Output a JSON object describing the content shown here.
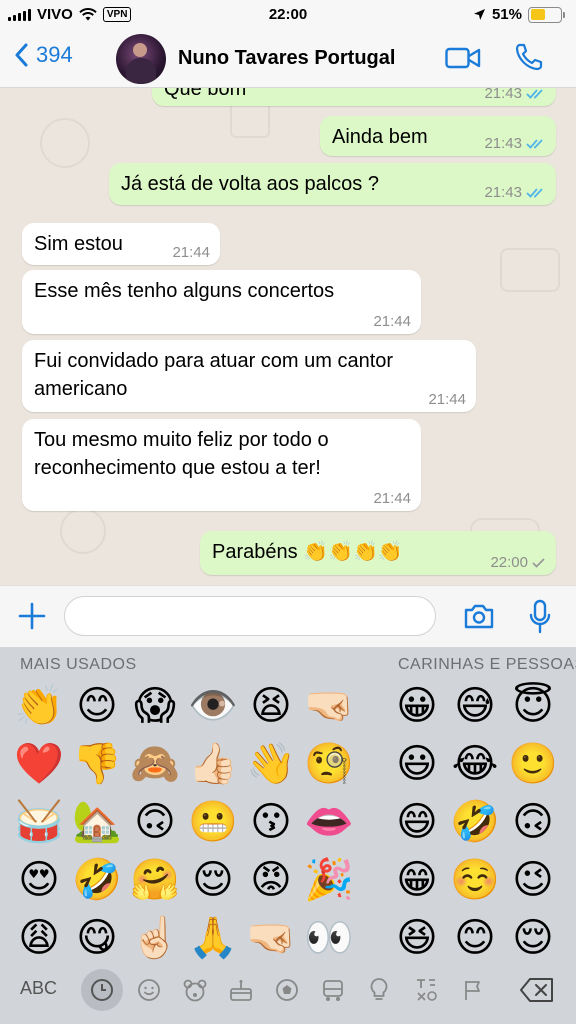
{
  "status_bar": {
    "carrier": "VIVO",
    "vpn": "VPN",
    "time": "22:00",
    "battery": "51%",
    "battery_level": 0.51
  },
  "header": {
    "back_count": "394",
    "contact_name": "Nuno Tavares Portugal"
  },
  "messages": [
    {
      "dir": "out",
      "text": "Que bom",
      "time": "21:43",
      "ticks": "read"
    },
    {
      "dir": "out",
      "text": "Ainda bem",
      "time": "21:43",
      "ticks": "read"
    },
    {
      "dir": "out",
      "text": "Já está de volta aos palcos ?",
      "time": "21:43",
      "ticks": "read"
    },
    {
      "dir": "in",
      "text": "Sim estou",
      "time": "21:44"
    },
    {
      "dir": "in",
      "text": "Esse mês tenho alguns concertos",
      "time": "21:44"
    },
    {
      "dir": "in",
      "text": "Fui convidado para atuar com um cantor",
      "text2": "americano",
      "time": "21:44"
    },
    {
      "dir": "in",
      "text": "Tou mesmo muito feliz por todo o",
      "text2": "reconhecimento que estou a ter!",
      "time": "21:44"
    },
    {
      "dir": "out",
      "text": "Parabéns 👏👏👏👏",
      "time": "22:00",
      "ticks": "sent"
    }
  ],
  "input": {
    "placeholder": ""
  },
  "keyboard": {
    "section_frequent": "MAIS USADOS",
    "section_faces": "CARINHAS E PESSOAS",
    "frequent": [
      [
        "👏",
        "😊",
        "😱",
        "👁️",
        "😫",
        "🤜🏻"
      ],
      [
        "❤️",
        "👎",
        "🙈",
        "👍🏻",
        "👋",
        "🧐"
      ],
      [
        "🥁",
        "🏡",
        "🙃",
        "😬",
        "😗",
        "👄"
      ],
      [
        "😍",
        "🤣",
        "🤗",
        "😌",
        "😡",
        "🎉"
      ],
      [
        "😩",
        "😋",
        "☝🏻",
        "🙏",
        "🤜🏻",
        "👀"
      ]
    ],
    "faces": [
      [
        "😀",
        "😅",
        "😇"
      ],
      [
        "😃",
        "😂",
        "🙂"
      ],
      [
        "😄",
        "🤣",
        "🙃"
      ],
      [
        "😁",
        "☺️",
        "😉"
      ],
      [
        "😆",
        "😊",
        "😌"
      ]
    ],
    "abc_label": "ABC",
    "categories": [
      "clock-icon",
      "smiley-icon",
      "bear-icon",
      "cake-icon",
      "ball-icon",
      "car-icon",
      "bulb-icon",
      "symbols-icon",
      "flag-icon"
    ]
  }
}
